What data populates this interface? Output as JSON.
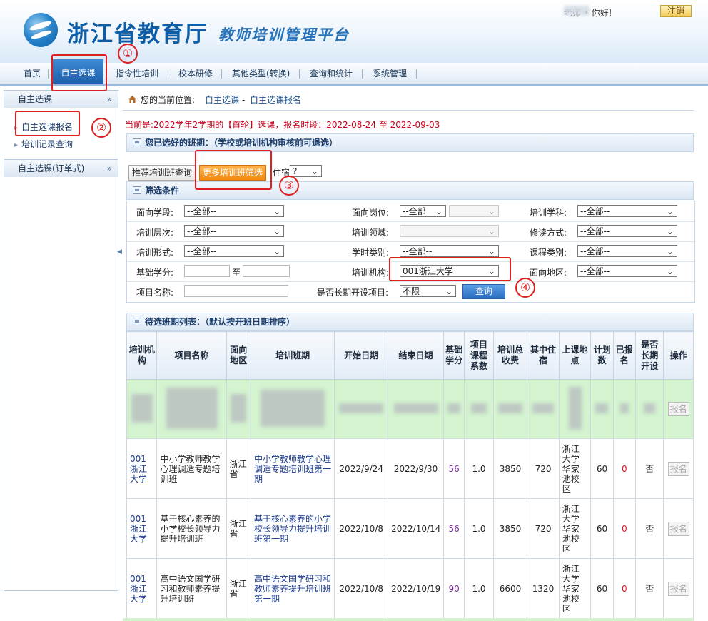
{
  "header": {
    "site_title": "浙江省教育厅",
    "platform_title": "教师培训管理平台",
    "greeting": "老师 • 你好!",
    "logout": "注销"
  },
  "nav": {
    "items": [
      "首页",
      "自主选课",
      "指令性培训",
      "校本研修",
      "其他类型(转换)",
      "查询和统计",
      "系统管理"
    ],
    "active": "自主选课"
  },
  "sidebar": {
    "section1": {
      "title": "自主选课",
      "items": [
        "自主选课报名",
        "培训记录查询"
      ]
    },
    "section2": {
      "title": "自主选课(订单式)"
    }
  },
  "breadcrumb": {
    "prefix": "您的当前位置:",
    "level1": "自主选课",
    "sep": "-",
    "level2": "自主选课报名"
  },
  "notice": "当前是:2022学年2学期的【首轮】选课，报名时段：2022-08-24 至 2022-09-03",
  "selected_section": "您已选好的班期：（学校或培训机构审核前可退选）",
  "tabs": {
    "recommend": "推荐培训班查询",
    "more": "更多培训班筛选",
    "lodging_label": "住宿",
    "lodging_value": "?"
  },
  "filter": {
    "title": "筛选条件",
    "rows": [
      [
        {
          "label": "面向学段:",
          "value": "--全部--"
        },
        {
          "label": "面向岗位:",
          "value": "--全部"
        },
        {
          "label": "培训学科:",
          "value": "--全部--"
        }
      ],
      [
        {
          "label": "培训层次:",
          "value": "--全部--"
        },
        {
          "label": "培训领域:",
          "value": ""
        },
        {
          "label": "修读方式:",
          "value": "--全部--"
        }
      ],
      [
        {
          "label": "培训形式:",
          "value": "--全部--"
        },
        {
          "label": "学时类别:",
          "value": "--全部--"
        },
        {
          "label": "课程类别:",
          "value": "--全部--"
        }
      ],
      [
        {
          "label": "基础学分:",
          "value": "",
          "to": "至"
        },
        {
          "label": "培训机构:",
          "value": "001浙江大学"
        },
        {
          "label": "面向地区:",
          "value": "--全部--"
        }
      ]
    ],
    "project_name_label": "项目名称:",
    "longterm_label": "是否长期开设项目:",
    "longterm_value": "不限",
    "query": "查询"
  },
  "list": {
    "title": "待选班期列表：（默认按开班日期排序）",
    "headers": [
      "培训机构",
      "项目名称",
      "面向地区",
      "培训班期",
      "开始日期",
      "结束日期",
      "基础学分",
      "项目课程系数",
      "培训总收费",
      "其中住宿",
      "上课地点",
      "计划数",
      "已报名",
      "是否长期开设",
      "操作"
    ],
    "blurred_action": "报名",
    "rows": [
      {
        "org": "001浙江大学",
        "project": "中小学教师教学心理调适专题培训班",
        "region": "浙江省",
        "class": "中小学教师教学心理调适专题培训班第一期",
        "start": "2022/9/24",
        "end": "2022/9/30",
        "credit": "56",
        "coef": "1.0",
        "fee": "3850",
        "lodging": "720",
        "place": "浙江大学华家池校区",
        "plan": "60",
        "signed": "0",
        "longterm": "否",
        "action": "报名"
      },
      {
        "org": "001浙江大学",
        "project": "基于核心素养的小学校长领导力提升培训班",
        "region": "浙江省",
        "class": "基于核心素养的小学校长领导力提升培训班第一期",
        "start": "2022/10/8",
        "end": "2022/10/14",
        "credit": "56",
        "coef": "1.0",
        "fee": "3850",
        "lodging": "720",
        "place": "浙江大学华家池校区",
        "plan": "60",
        "signed": "0",
        "longterm": "否",
        "action": "报名"
      },
      {
        "org": "001浙江大学",
        "project": "高中语文国学研习和教师素养提升培训班",
        "region": "浙江省",
        "class": "高中语文国学研习和教师素养提升培训班第一期",
        "start": "2022/10/8",
        "end": "2022/10/19",
        "credit": "90",
        "coef": "1.0",
        "fee": "6600",
        "lodging": "1320",
        "place": "浙江大学华家池校区",
        "plan": "60",
        "signed": "0",
        "longterm": "否",
        "action": "报名"
      }
    ]
  },
  "annotations": [
    "①",
    "②",
    "③",
    "④"
  ],
  "colors": {
    "brand_blue": "#0d5ea6",
    "annotation_red": "#e02020",
    "notice_red": "#c8001a",
    "row_highlight": "#d4f4d0"
  }
}
